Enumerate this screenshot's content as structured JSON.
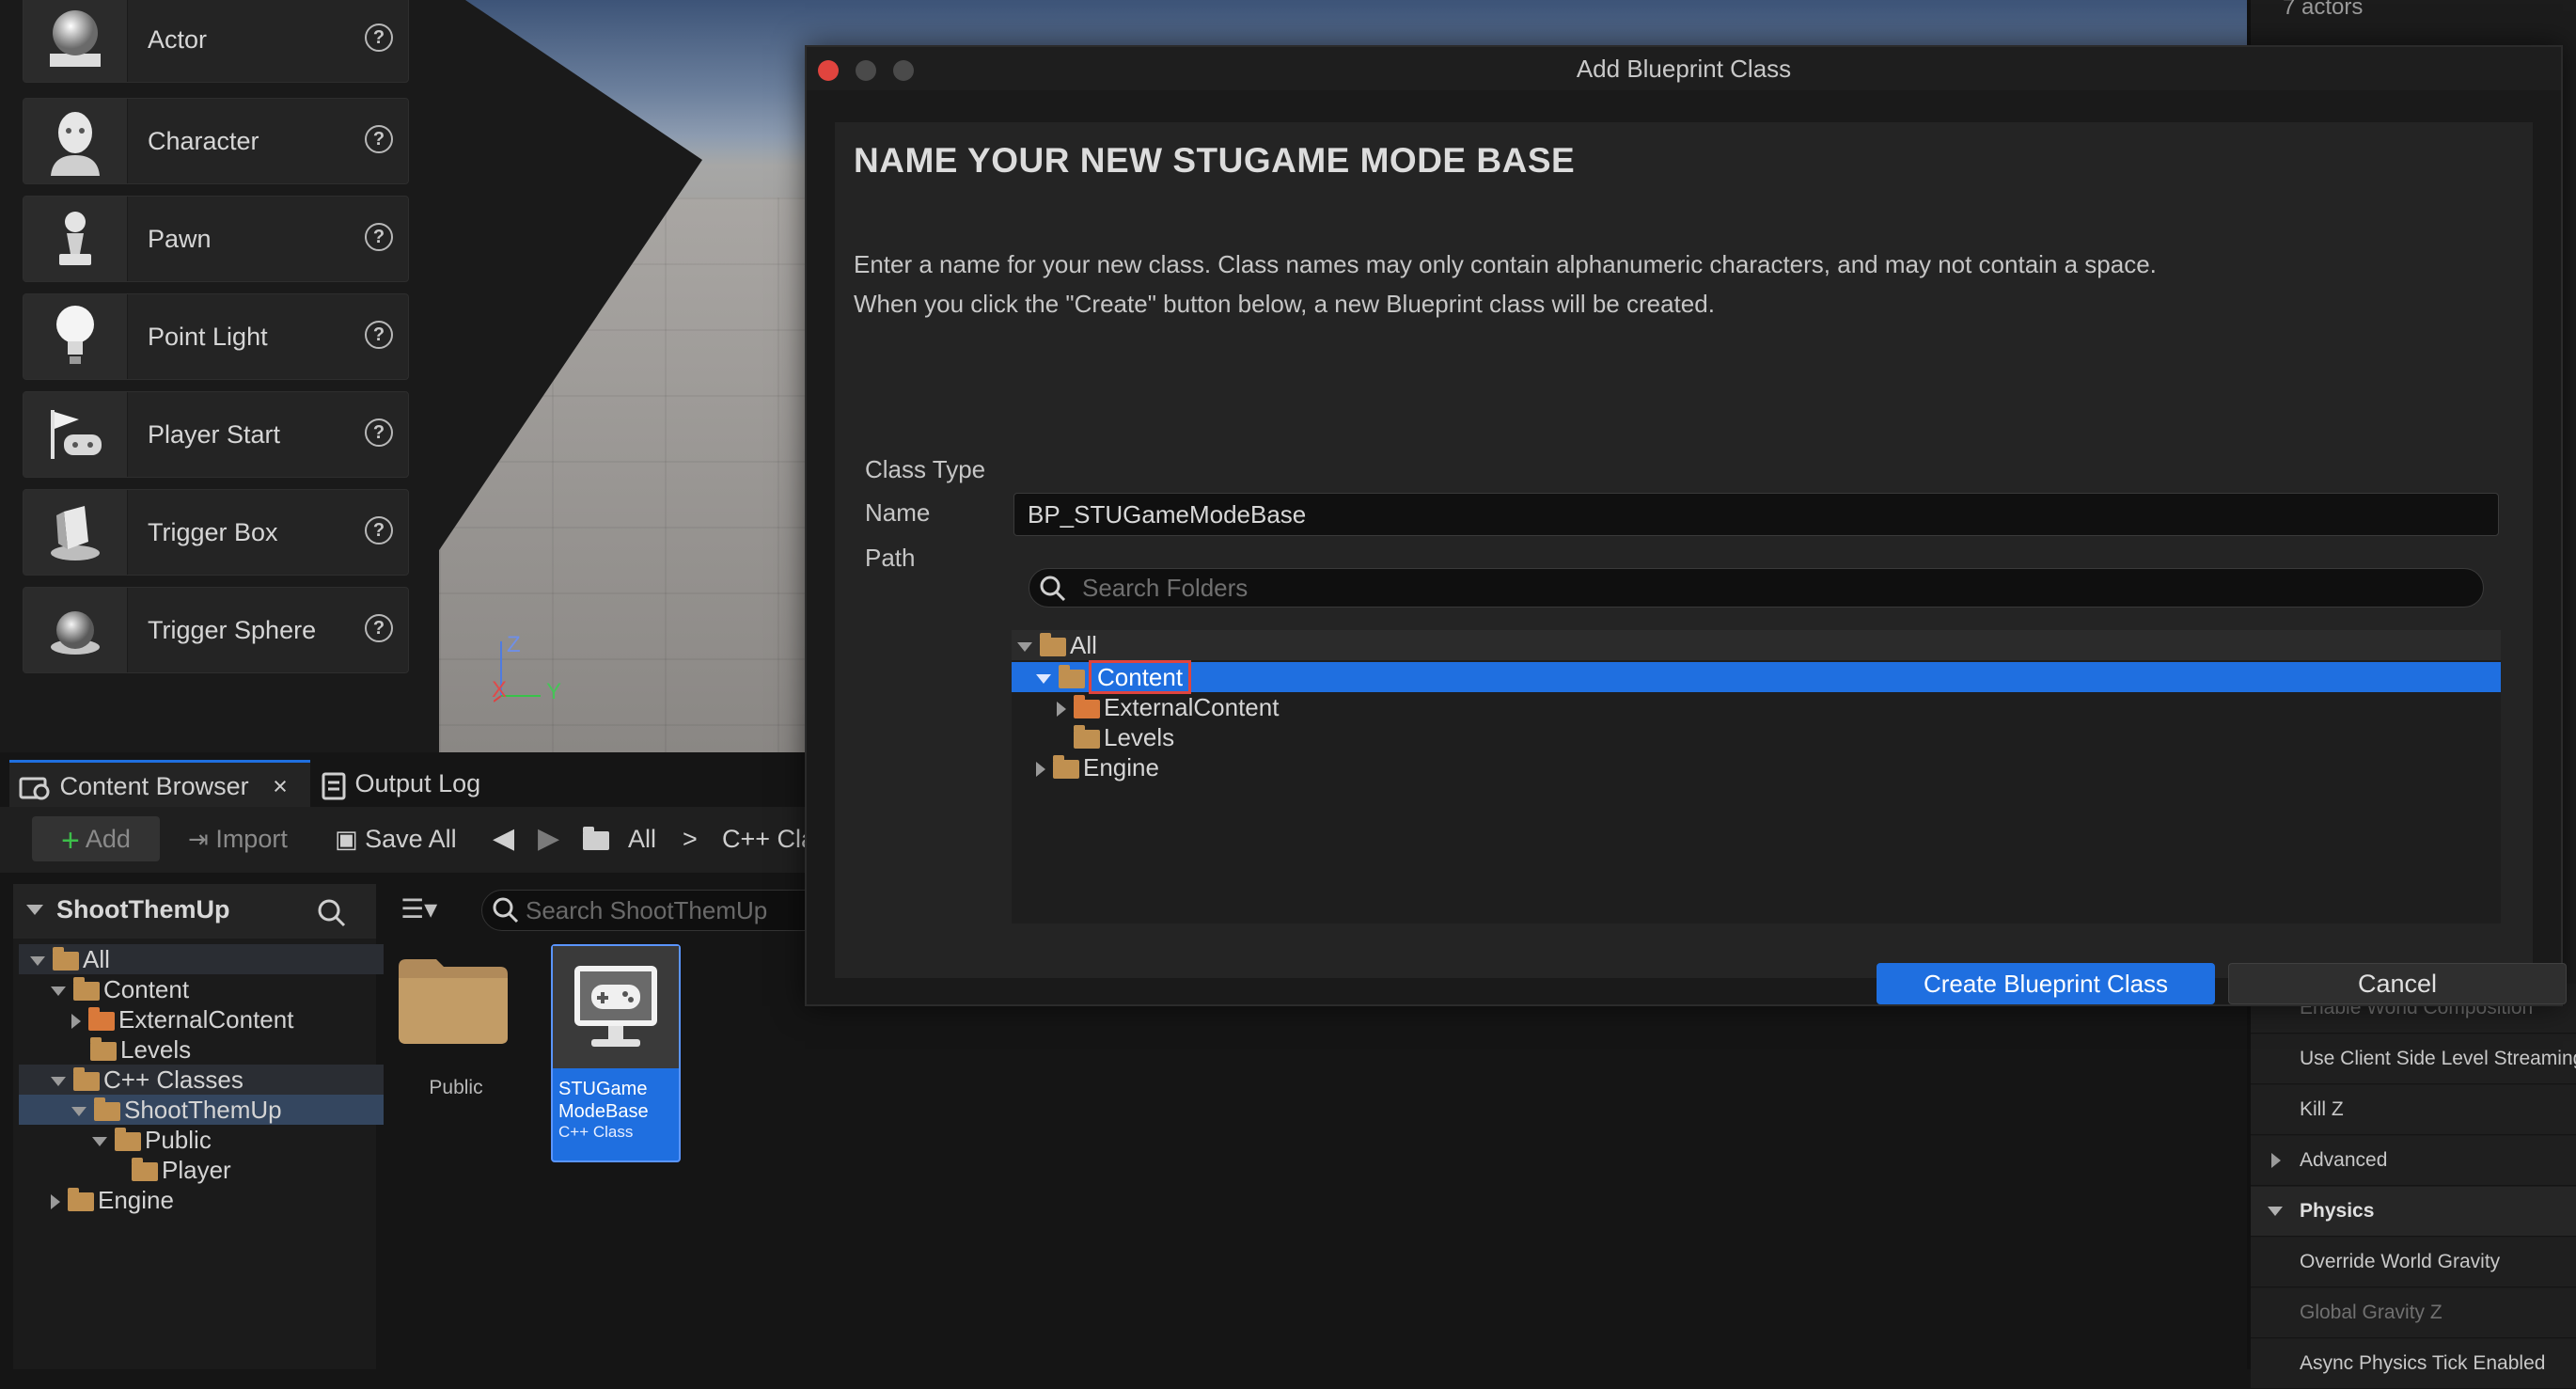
{
  "place_actors": {
    "items": [
      {
        "label": "Actor",
        "icon": "sphere-actor-icon"
      },
      {
        "label": "Character",
        "icon": "character-icon"
      },
      {
        "label": "Pawn",
        "icon": "pawn-icon"
      },
      {
        "label": "Point Light",
        "icon": "light-bulb-icon"
      },
      {
        "label": "Player Start",
        "icon": "player-start-icon"
      },
      {
        "label": "Trigger Box",
        "icon": "trigger-box-icon"
      },
      {
        "label": "Trigger Sphere",
        "icon": "trigger-sphere-icon"
      }
    ],
    "help_glyph": "?"
  },
  "viewport": {
    "axis_z": "Z",
    "axis_x": "X",
    "axis_y": "Y"
  },
  "outliner": {
    "actor_count": "7 actors"
  },
  "details": {
    "rows": [
      {
        "label": "Enable World Composition",
        "style": "dim"
      },
      {
        "label": "Use Client Side Level Streaming",
        "style": "normal"
      },
      {
        "label": "Kill Z",
        "style": "normal"
      },
      {
        "label": "Advanced",
        "style": "normal"
      },
      {
        "label": "Physics",
        "style": "bold"
      },
      {
        "label": "Override World Gravity",
        "style": "normal"
      },
      {
        "label": "Global Gravity Z",
        "style": "dim"
      },
      {
        "label": "Async Physics Tick Enabled",
        "style": "normal"
      }
    ]
  },
  "content_browser": {
    "tab_label": "Content Browser",
    "tab_close": "×",
    "output_log_label": "Output Log",
    "toolbar": {
      "add_label": "Add",
      "import_label": "Import",
      "save_all_label": "Save All",
      "path_all": "All",
      "path_sep": ">",
      "path_cpp": "C++ Cla"
    },
    "tree_header": "ShootThemUp",
    "tree": [
      {
        "label": "All"
      },
      {
        "label": "Content"
      },
      {
        "label": "ExternalContent"
      },
      {
        "label": "Levels"
      },
      {
        "label": "C++ Classes"
      },
      {
        "label": "ShootThemUp"
      },
      {
        "label": "Public"
      },
      {
        "label": "Player"
      },
      {
        "label": "Engine"
      }
    ],
    "search_placeholder": "Search ShootThemUp",
    "assets": [
      {
        "name": "Public"
      },
      {
        "name": "STUGame ModeBase",
        "name_line1": "STUGame",
        "name_line2": "ModeBase",
        "type": "C++ Class"
      }
    ]
  },
  "dialog": {
    "title": "Add Blueprint Class",
    "heading": "NAME YOUR NEW STUGAME MODE BASE",
    "desc_line1": "Enter a name for your new class. Class names may only contain alphanumeric characters, and may not contain a space.",
    "desc_line2": "When you click the \"Create\" button below, a new Blueprint class will be created.",
    "class_type_label": "Class Type",
    "name_label": "Name",
    "name_value": "BP_STUGameModeBase",
    "path_label": "Path",
    "search_placeholder": "Search Folders",
    "folders": [
      {
        "label": "All"
      },
      {
        "label": "Content"
      },
      {
        "label": "ExternalContent"
      },
      {
        "label": "Levels"
      },
      {
        "label": "Engine"
      }
    ],
    "create_label": "Create Blueprint Class",
    "cancel_label": "Cancel"
  },
  "colors": {
    "accent_blue": "#1f6fe0",
    "folder_orange": "#d9793a",
    "folder_tan": "#c09050",
    "close_red": "#e0443e"
  }
}
